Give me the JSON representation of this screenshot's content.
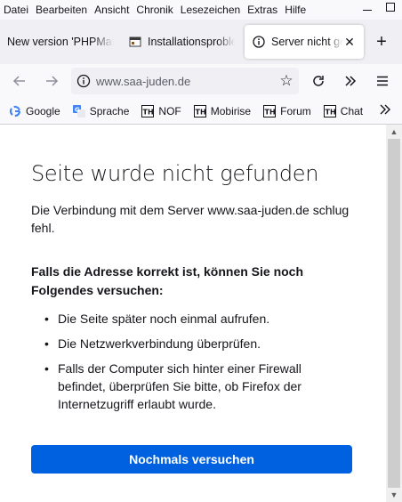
{
  "menu": [
    "Datei",
    "Bearbeiten",
    "Ansicht",
    "Chronik",
    "Lesezeichen",
    "Extras",
    "Hilfe"
  ],
  "tabs": [
    {
      "label": "New version 'PHPMail",
      "icon": "none"
    },
    {
      "label": "Installationsproble",
      "icon": "page-icon"
    },
    {
      "label": "Server nicht gef",
      "icon": "info-icon",
      "active": true,
      "close": "✕"
    }
  ],
  "new_tab": "+",
  "urlbar": {
    "url": "www.saa-juden.de"
  },
  "bookmarks": [
    {
      "label": "Google",
      "icon": "google-icon"
    },
    {
      "label": "Sprache",
      "icon": "translate-icon"
    },
    {
      "label": "NOF",
      "icon": "th-icon"
    },
    {
      "label": "Mobirise",
      "icon": "th-icon"
    },
    {
      "label": "Forum",
      "icon": "th-icon"
    },
    {
      "label": "Chat",
      "icon": "th-icon"
    }
  ],
  "error": {
    "title": "Seite wurde nicht gefunden",
    "description": "Die Verbindung mit dem Server www.saa-juden.de schlug fehl.",
    "hint": "Falls die Adresse korrekt ist, können Sie noch Folgendes versuchen:",
    "tips": [
      "Die Seite später noch einmal aufrufen.",
      "Die Netzwerkverbindung überprüfen.",
      "Falls der Computer sich hinter einer Firewall befindet, überprüfen Sie bitte, ob Firefox der Internetzugriff erlaubt wurde."
    ],
    "retry_label": "Nochmals versuchen"
  },
  "colors": {
    "accent": "#0061e0",
    "toolbar": "#f9f9fb",
    "tabstrip": "#f0f0f4"
  }
}
